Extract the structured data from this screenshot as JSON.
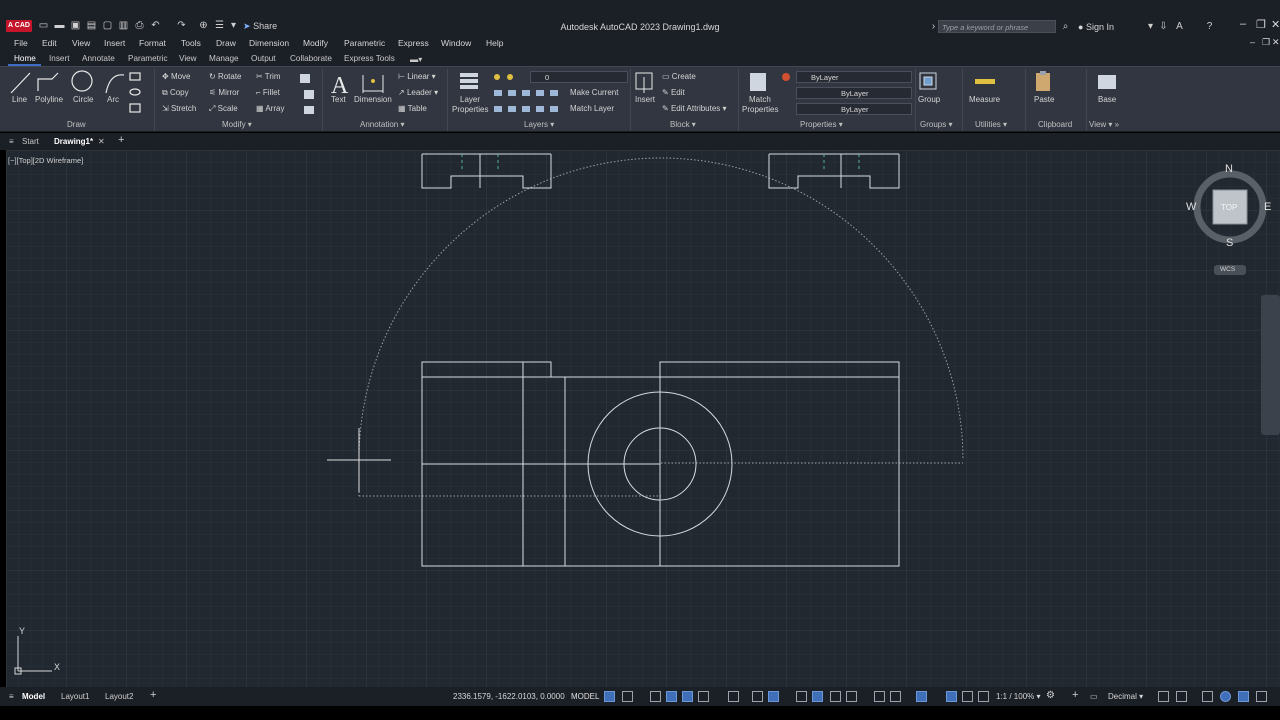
{
  "titlebar": {
    "logo_text": "A CAD",
    "share_label": "Share",
    "app_title": "Autodesk AutoCAD 2023    Drawing1.dwg",
    "search_placeholder": "Type a keyword or phrase",
    "signin_label": "Sign In"
  },
  "menu": [
    "File",
    "Edit",
    "View",
    "Insert",
    "Format",
    "Tools",
    "Draw",
    "Dimension",
    "Modify",
    "Parametric",
    "Express",
    "Window",
    "Help"
  ],
  "ribbon_tabs": [
    "Home",
    "Insert",
    "Annotate",
    "Parametric",
    "View",
    "Manage",
    "Output",
    "Collaborate",
    "Express Tools"
  ],
  "active_tab": "Home",
  "ribbon": {
    "draw": {
      "line": "Line",
      "polyline": "Polyline",
      "circle": "Circle",
      "arc": "Arc",
      "title": "Draw"
    },
    "modify": {
      "move": "Move",
      "rotate": "Rotate",
      "trim": "Trim",
      "copy": "Copy",
      "mirror": "Mirror",
      "fillet": "Fillet",
      "stretch": "Stretch",
      "scale": "Scale",
      "array": "Array",
      "title": "Modify"
    },
    "annotation": {
      "text": "Text",
      "dimension": "Dimension",
      "linear": "Linear",
      "leader": "Leader",
      "table": "Table",
      "title": "Annotation"
    },
    "layers": {
      "layer_properties_1": "Layer",
      "layer_properties_2": "Properties",
      "layer_value": "0",
      "make_current": "Make Current",
      "match_layer": "Match Layer",
      "title": "Layers"
    },
    "block": {
      "insert": "Insert",
      "create": "Create",
      "edit": "Edit",
      "edit_attributes": "Edit Attributes",
      "title": "Block"
    },
    "properties": {
      "match_1": "Match",
      "match_2": "Properties",
      "color": "ByLayer",
      "linetype": "ByLayer",
      "lineweight": "ByLayer",
      "title": "Properties"
    },
    "groups": {
      "group": "Group",
      "title": "Groups"
    },
    "utilities": {
      "measure": "Measure",
      "title": "Utilities"
    },
    "clipboard": {
      "paste": "Paste",
      "title": "Clipboard"
    },
    "view": {
      "base": "Base",
      "title": "View"
    }
  },
  "file_tabs": {
    "start": "Start",
    "drawing": "Drawing1*"
  },
  "viewport": {
    "label": "[−][Top][2D Wireframe]",
    "viewcube": {
      "n": "N",
      "s": "S",
      "e": "E",
      "w": "W",
      "top": "TOP",
      "wcs": "WCS"
    },
    "ucs": {
      "x": "X",
      "y": "Y"
    }
  },
  "status": {
    "layouts": [
      "Model",
      "Layout1",
      "Layout2"
    ],
    "coords": "2336.1579, -1622.0103, 0.0000",
    "model": "MODEL",
    "scale": "1:1 / 100%",
    "units": "Decimal"
  },
  "colors": {
    "canvas_bg": "#212830",
    "titlebar_bg": "#1b1f26",
    "ribbon_bg": "#313640",
    "accent": "#3d6fc9",
    "logo_red": "#c4152a"
  }
}
